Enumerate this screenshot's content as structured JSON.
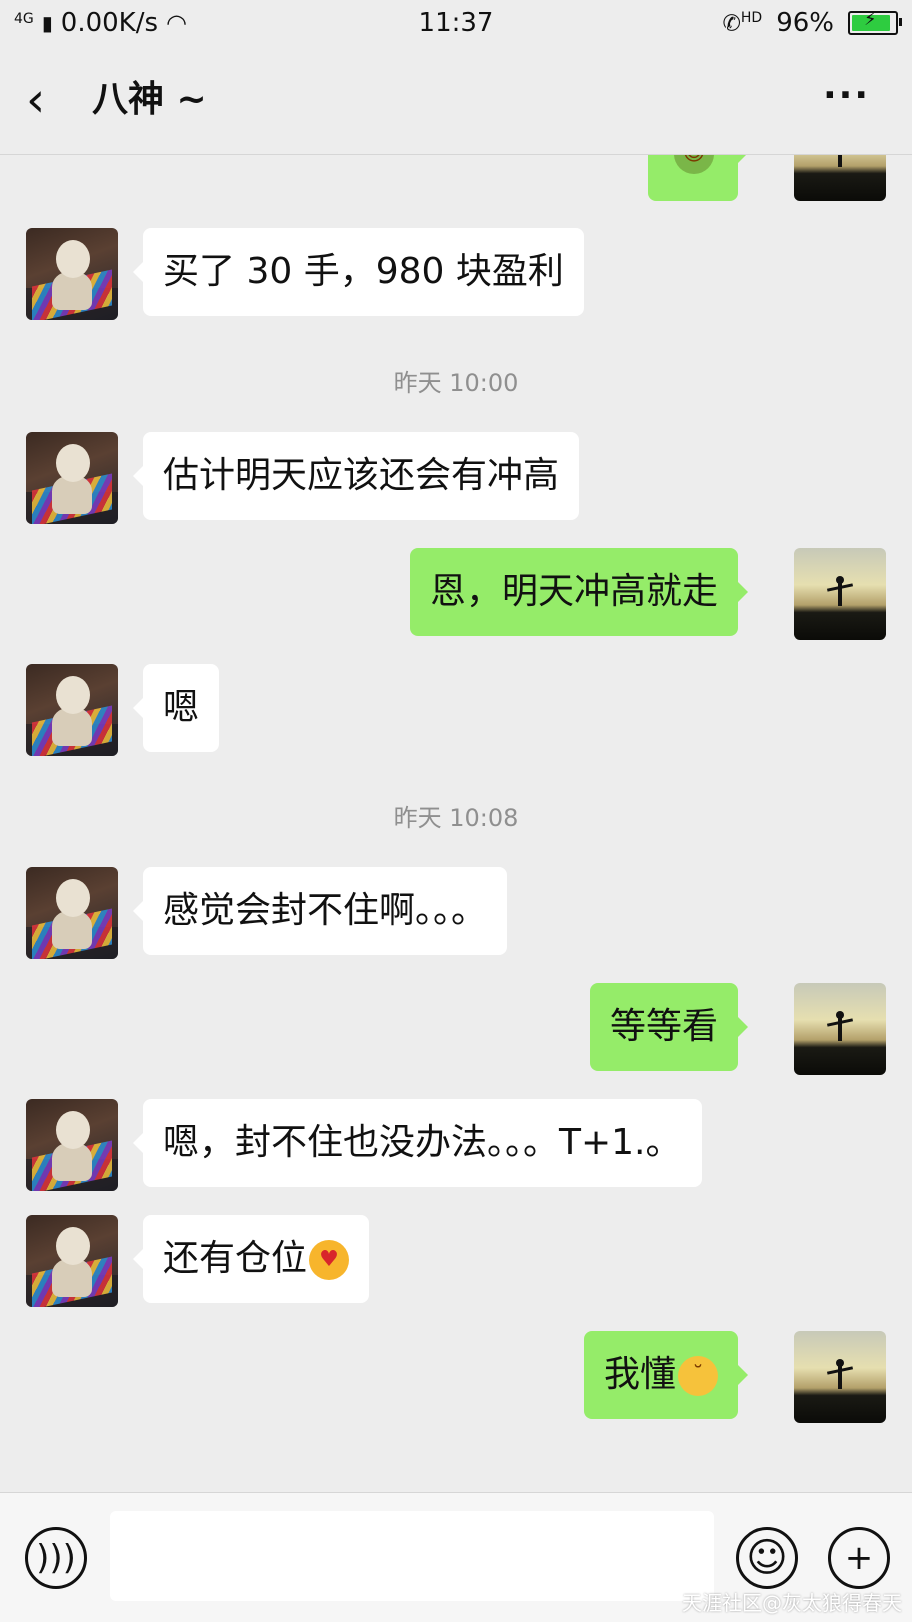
{
  "status_bar": {
    "network": "4G",
    "speed": "0.00K/s",
    "time": "11:37",
    "call_badge": "HD",
    "battery": "96%",
    "battery_level": 0.96
  },
  "header": {
    "back_icon": "chevron-left-icon",
    "title": "八神 ~",
    "more_icon": "more-dots-icon"
  },
  "messages": [
    {
      "type": "partial_sent",
      "avatar": "sunset-avatar"
    },
    {
      "type": "received",
      "text": "买了 30 手，980 块盈利",
      "avatar": "dog-avatar"
    },
    {
      "type": "time",
      "text": "昨天 10:00"
    },
    {
      "type": "received",
      "text": "估计明天应该还会有冲高",
      "avatar": "dog-avatar"
    },
    {
      "type": "sent",
      "text": "恩，明天冲高就走",
      "avatar": "sunset-avatar"
    },
    {
      "type": "received",
      "text": "嗯",
      "avatar": "dog-avatar"
    },
    {
      "type": "time",
      "text": "昨天 10:08"
    },
    {
      "type": "received",
      "text": "感觉会封不住啊。。。",
      "avatar": "dog-avatar"
    },
    {
      "type": "sent",
      "text": "等等看",
      "avatar": "sunset-avatar"
    },
    {
      "type": "received",
      "text": "嗯，封不住也没办法。。。T+1.。",
      "avatar": "dog-avatar"
    },
    {
      "type": "received",
      "text": "还有仓位",
      "emoji": "heart-eyes-emoji",
      "avatar": "dog-avatar"
    },
    {
      "type": "sent",
      "text": "我懂",
      "emoji": "smirk-emoji",
      "avatar": "sunset-avatar"
    }
  ],
  "bottom_bar": {
    "voice_icon": "voice-icon",
    "emoji_icon": "smiley-icon",
    "add_icon": "plus-icon",
    "input_value": ""
  },
  "watermark": "天涯社区@灰太狼得春天",
  "colors": {
    "sent_bubble": "#95ec69",
    "received_bubble": "#ffffff",
    "background": "#ededed"
  }
}
